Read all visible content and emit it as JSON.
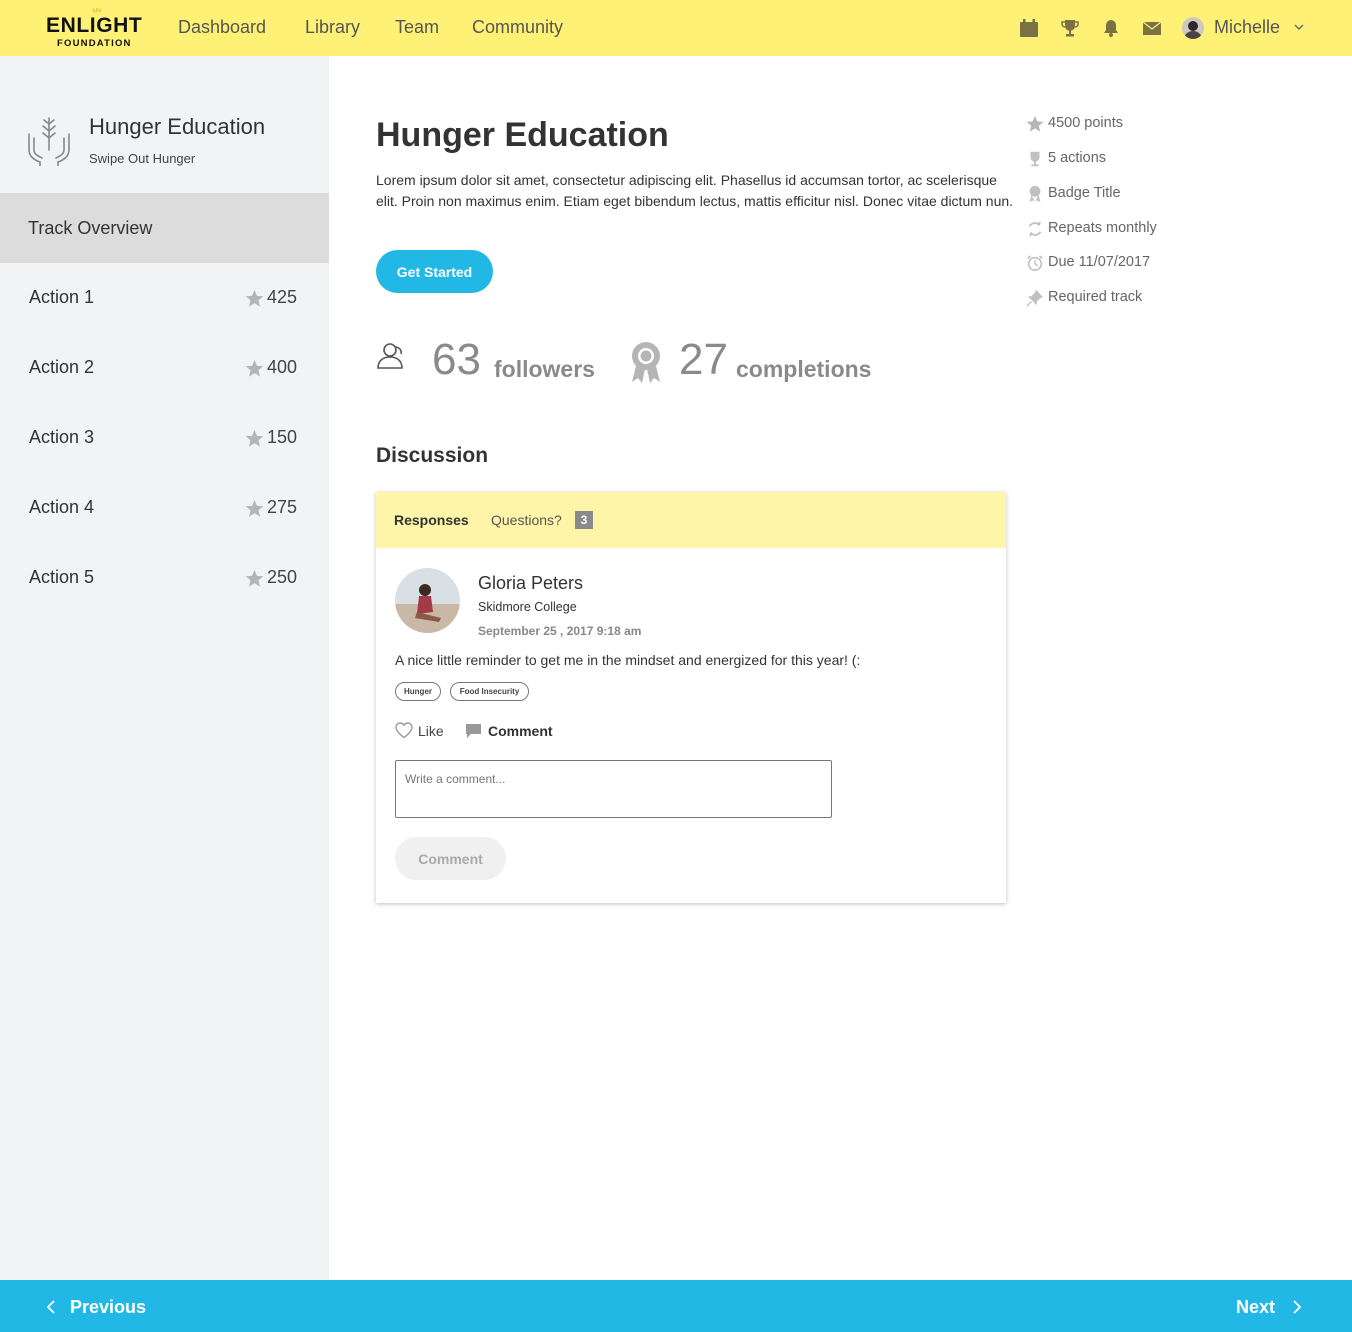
{
  "brand": {
    "name": "ENLIGHT",
    "sub": "FOUNDATION",
    "accent": "#fef176"
  },
  "nav": {
    "links": [
      "Dashboard",
      "Library",
      "Team",
      "Community"
    ]
  },
  "user": {
    "name": "Michelle"
  },
  "icons": [
    "calendar-icon",
    "trophy-icon",
    "bell-icon",
    "mail-icon",
    "chevron-down-icon"
  ],
  "sidebar": {
    "track_title": "Hunger Education",
    "track_subtitle": "Swipe Out Hunger",
    "overview_label": "Track Overview",
    "actions": [
      {
        "label": "Action 1",
        "points": "425"
      },
      {
        "label": "Action 2",
        "points": "400"
      },
      {
        "label": "Action 3",
        "points": "150"
      },
      {
        "label": "Action 4",
        "points": "275"
      },
      {
        "label": "Action 5",
        "points": "250"
      }
    ]
  },
  "main": {
    "title": "Hunger Education",
    "description": "Lorem ipsum dolor sit amet, consectetur adipiscing elit. Phasellus id accumsan tortor, ac scelerisque elit. Proin non maximus enim. Etiam eget bibendum lectus, mattis efficitur nisl. Donec vitae dictum nun.",
    "cta_label": "Get Started",
    "cta_color": "#21b8e6",
    "stats": {
      "followers_count": "63",
      "followers_label": "followers",
      "completions_count": "27",
      "completions_label": "completions"
    },
    "meta": [
      "4500 points",
      "5 actions",
      "Badge Title",
      "Repeats monthly",
      "Due 11/07/2017",
      "Required track"
    ]
  },
  "discussion": {
    "title": "Discussion",
    "tabs": {
      "responses": "Responses",
      "questions": "Questions?",
      "questions_count": "3"
    },
    "post": {
      "author": "Gloria Peters",
      "school": "Skidmore College",
      "date": "September 25 , 2017 9:18 am",
      "text": "A nice little reminder to get me in the mindset and energized for this year! (:",
      "tags": [
        "Hunger",
        "Food Insecurity"
      ],
      "like_label": "Like",
      "comment_label": "Comment"
    },
    "comment_placeholder": "Write a comment...",
    "comment_button": "Comment"
  },
  "footer": {
    "previous": "Previous",
    "next": "Next",
    "color": "#21b8e6"
  }
}
